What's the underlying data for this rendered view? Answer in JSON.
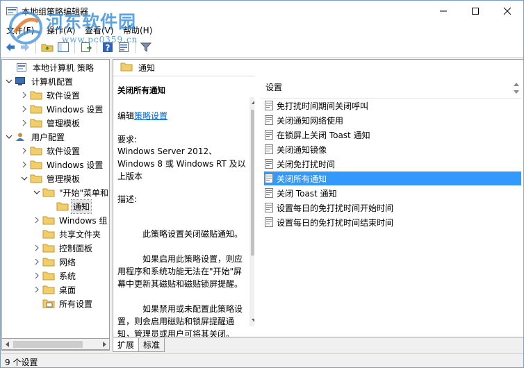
{
  "window": {
    "title": "本地组策略编辑器"
  },
  "watermark": {
    "line1": "河东软件园",
    "line2": "www.pc0359.cn"
  },
  "menu": {
    "items": [
      "文件(F)",
      "操作(A)",
      "查看(V)",
      "帮助(H)"
    ]
  },
  "tree": {
    "items": [
      {
        "label": "本地计算机 策略",
        "icon": "policy-icon"
      },
      {
        "label": "计算机配置",
        "icon": "computer-icon"
      },
      {
        "label": "软件设置",
        "icon": "folder-icon"
      },
      {
        "label": "Windows 设置",
        "icon": "folder-icon"
      },
      {
        "label": "管理模板",
        "icon": "folder-icon"
      },
      {
        "label": "用户配置",
        "icon": "user-icon"
      },
      {
        "label": "软件设置",
        "icon": "folder-icon"
      },
      {
        "label": "Windows 设置",
        "icon": "folder-icon"
      },
      {
        "label": "管理模板",
        "icon": "folder-icon"
      },
      {
        "label": "\"开始\"菜单和",
        "icon": "folder-icon"
      },
      {
        "label": "通知",
        "icon": "folder-icon"
      },
      {
        "label": "Windows 组",
        "icon": "folder-icon"
      },
      {
        "label": "共享文件夹",
        "icon": "folder-icon"
      },
      {
        "label": "控制面板",
        "icon": "folder-icon"
      },
      {
        "label": "网络",
        "icon": "folder-icon"
      },
      {
        "label": "系统",
        "icon": "folder-icon"
      },
      {
        "label": "桌面",
        "icon": "folder-icon"
      },
      {
        "label": "所有设置",
        "icon": "all-settings-icon"
      }
    ]
  },
  "right_header": {
    "label": "通知"
  },
  "description": {
    "title": "关闭所有通知",
    "edit_prefix": "编辑",
    "edit_link": "策略设置",
    "requirements_label": "要求:",
    "requirements": "Windows Server 2012、Windows 8 或 Windows RT 及以上版本",
    "description_label": "描述:",
    "p1": "此策略设置关闭磁贴通知。",
    "p2": "如果启用此策略设置，则应用程序和系统功能无法在\"开始\"屏幕中更新其磁贴和磁贴锁屏提醒。",
    "p3": "如果禁用或未配置此策略设置，则会启用磁贴和锁屏提醒通知，管理员或用户可将其关闭。"
  },
  "settings": {
    "column": "设置",
    "items": [
      "免打扰时间期间关闭呼叫",
      "关闭通知网络使用",
      "在锁屏上关闭 Toast 通知",
      "关闭通知镜像",
      "关闭免打扰时间",
      "关闭所有通知",
      "关闭 Toast 通知",
      "设置每日的免打扰时间开始时间",
      "设置每日的免打扰时间结束时间"
    ],
    "selected_index": 5
  },
  "tabs": {
    "extended": "扩展",
    "standard": "标准"
  },
  "status": {
    "text": "9 个设置"
  }
}
